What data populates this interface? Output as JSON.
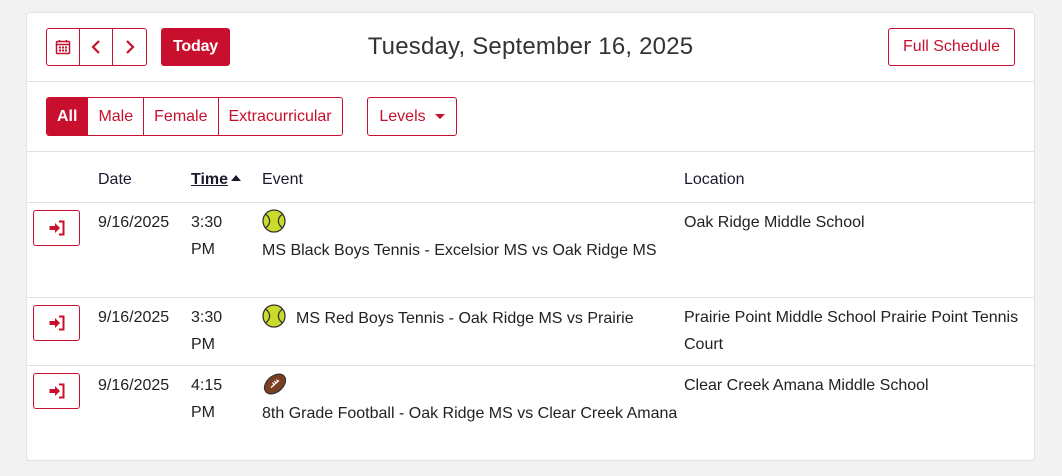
{
  "header": {
    "today_label": "Today",
    "date_title": "Tuesday, September 16, 2025",
    "full_schedule_label": "Full Schedule",
    "icons": [
      "calendar-icon",
      "chevron-left-icon",
      "chevron-right-icon"
    ]
  },
  "filters": {
    "items": [
      {
        "label": "All",
        "active": true
      },
      {
        "label": "Male",
        "active": false
      },
      {
        "label": "Female",
        "active": false
      },
      {
        "label": "Extracurricular",
        "active": false
      }
    ],
    "levels_label": "Levels"
  },
  "table": {
    "columns": [
      "Date",
      "Time",
      "Event",
      "Location"
    ],
    "rows": [
      {
        "date": "9/16/2025",
        "time_1": "3:30",
        "time_2": "PM",
        "sport_icon": "tennis-ball-icon",
        "event": "MS Black Boys Tennis - Excelsior MS vs Oak Ridge MS",
        "location": "Oak Ridge Middle School"
      },
      {
        "date": "9/16/2025",
        "time_1": "3:30",
        "time_2": "PM",
        "sport_icon": "tennis-ball-icon",
        "event": "MS Red Boys Tennis - Oak Ridge MS vs Prairie",
        "location": "Prairie Point Middle School Prairie Point Tennis Court"
      },
      {
        "date": "9/16/2025",
        "time_1": "4:15",
        "time_2": "PM",
        "sport_icon": "football-icon",
        "event": "8th Grade Football - Oak Ridge MS vs Clear Creek Amana",
        "location": "Clear Creek Amana Middle School"
      }
    ]
  },
  "colors": {
    "accent": "#c8102e",
    "heading": "#1a1a2e",
    "background": "#f2f2f2"
  }
}
